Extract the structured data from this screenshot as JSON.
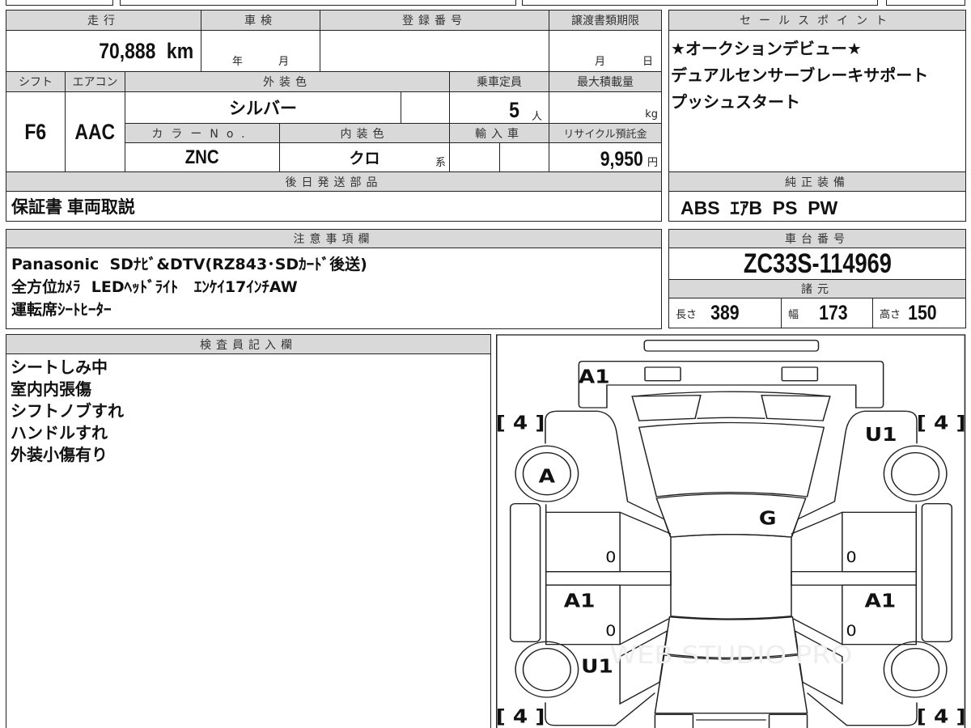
{
  "sheet": {
    "mileage": {
      "label": "走行",
      "value": "70,888",
      "unit": "km"
    },
    "inspection": {
      "label": "車検",
      "year_unit": "年",
      "month_unit": "月"
    },
    "registration": {
      "label": "登録番号"
    },
    "transfer_deadline": {
      "label": "譲渡書類期限",
      "month_unit": "月",
      "day_unit": "日"
    },
    "shift": {
      "label": "シフト",
      "value": "F6"
    },
    "aircon": {
      "label": "エアコン",
      "value": "AAC"
    },
    "exterior_color": {
      "label": "外装色",
      "value": "シルバー"
    },
    "capacity": {
      "label": "乗車定員",
      "value": "5",
      "unit": "人"
    },
    "max_load": {
      "label": "最大積載量",
      "unit": "kg"
    },
    "color_no": {
      "label": "カラーNo.",
      "value": "ZNC"
    },
    "interior_color": {
      "label": "内装色",
      "value": "クロ",
      "unit": "系"
    },
    "import": {
      "label": "輸入車"
    },
    "recycle_fee": {
      "label": "リサイクル預託金",
      "value": "9,950",
      "unit": "円"
    },
    "later_parts": {
      "label": "後日発送部品",
      "value": "保証書 車両取説"
    },
    "sales_points": {
      "label": "セールスポイント",
      "lines": [
        "★オークションデビュー★",
        "デュアルセンサーブレーキサポート",
        "プッシュスタート"
      ]
    },
    "equipment": {
      "label": "純正装備",
      "value": "ABS  ｴｱB  PS  PW"
    },
    "notes": {
      "label": "注意事項欄",
      "lines": [
        "Panasonic  SDﾅﾋﾞ&DTV(RZ843･SDｶｰﾄﾞ後送)",
        "全方位ｶﾒﾗ  LEDﾍｯﾄﾞﾗｲﾄ   ｴﾝｹｲ17ｲﾝﾁAW",
        "運転席ｼｰﾄﾋｰﾀｰ"
      ]
    },
    "chassis": {
      "label": "車台番号",
      "value": "ZC33S-114969"
    },
    "specs": {
      "label": "諸元",
      "length_label": "長さ",
      "length": "389",
      "width_label": "幅",
      "width": "173",
      "height_label": "高さ",
      "height": "150"
    },
    "inspector": {
      "label": "検査員記入欄",
      "lines": [
        "シートしみ中",
        "室内内張傷",
        "シフトノブすれ",
        "ハンドルすれ",
        "外装小傷有り"
      ]
    }
  },
  "diagram": {
    "marks": {
      "front_bumper": "A1",
      "left_front_tire": "[ 4 ]",
      "right_front_tire": "[ 4 ]",
      "left_rear_tire": "[ 4 ]",
      "right_rear_tire": "[ 4 ]",
      "left_front_fender": "A",
      "right_front_fender": "U1",
      "windshield": "G",
      "left_front_door": "0",
      "left_rear_door_top": "A1",
      "left_rear_door": "0",
      "right_front_door": "0",
      "right_rear_door_top": "A1",
      "right_rear_door": "0",
      "left_rear_fender": "U1"
    },
    "watermark": "WEB STUDIO PRO"
  }
}
